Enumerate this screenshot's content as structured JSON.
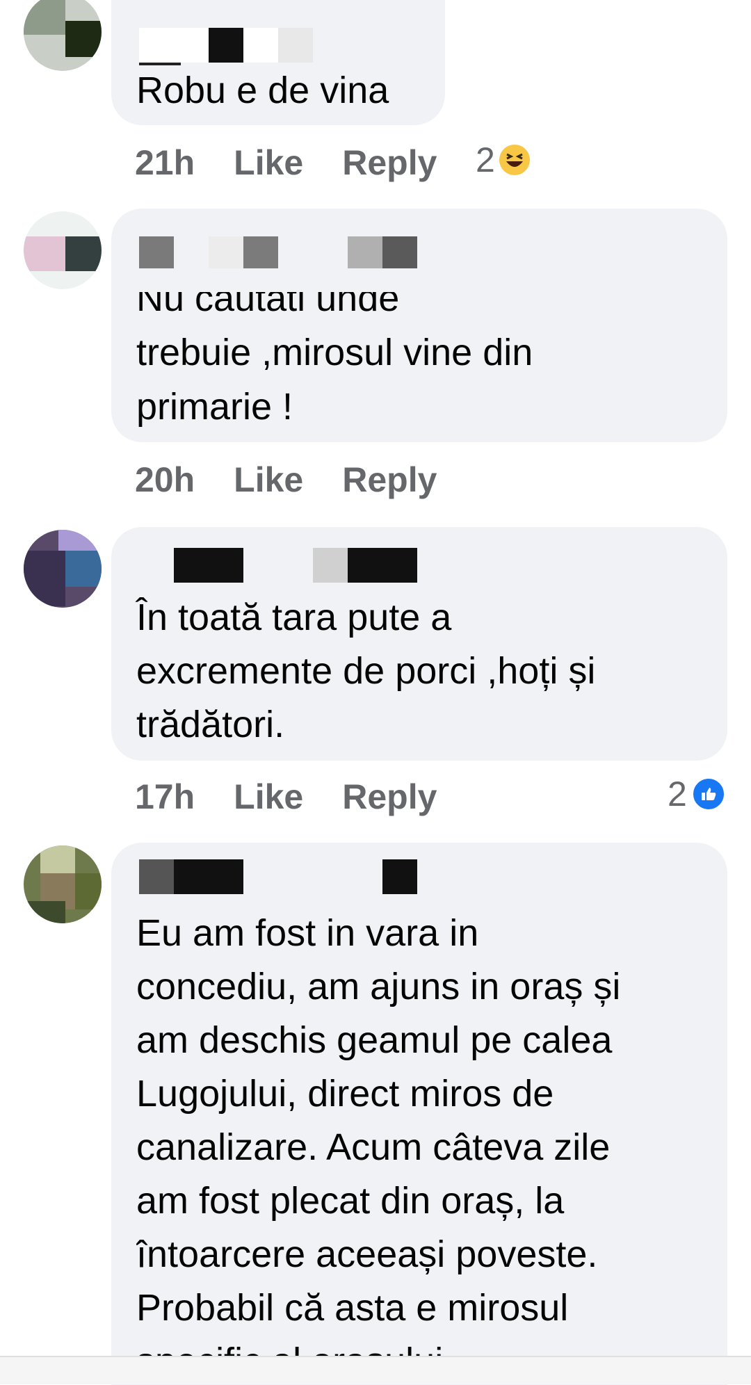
{
  "comments": [
    {
      "text": "Robu e de vina",
      "time": "21h",
      "like_label": "Like",
      "reply_label": "Reply",
      "reaction_count": "2",
      "reaction_icon": "haha-emoji-icon"
    },
    {
      "text": "Nu cautati unde\ntrebuie ,mirosul vine din\nprimarie !",
      "time": "20h",
      "like_label": "Like",
      "reply_label": "Reply"
    },
    {
      "text": "În toată tara pute a\nexcremente de porci ,hoți și\ntrădători.",
      "time": "17h",
      "like_label": "Like",
      "reply_label": "Reply",
      "reaction_count": "2",
      "reaction_icon": "like-thumb-icon"
    },
    {
      "text": "Eu am fost in vara in\nconcediu, am ajuns in oraș și\nam deschis geamul pe calea\nLugojului, direct miros de\ncanalizare. Acum câteva zile\nam fost plecat din oraș, la\nîntoarcere aceeași poveste.\nProbabil că asta e mirosul\nspecific al orașului"
    }
  ],
  "colors": {
    "bubble": "#f0f2f5",
    "meta_text": "#65676b",
    "like_blue": "#1877f2",
    "haha_yellow": "#f7c745"
  }
}
